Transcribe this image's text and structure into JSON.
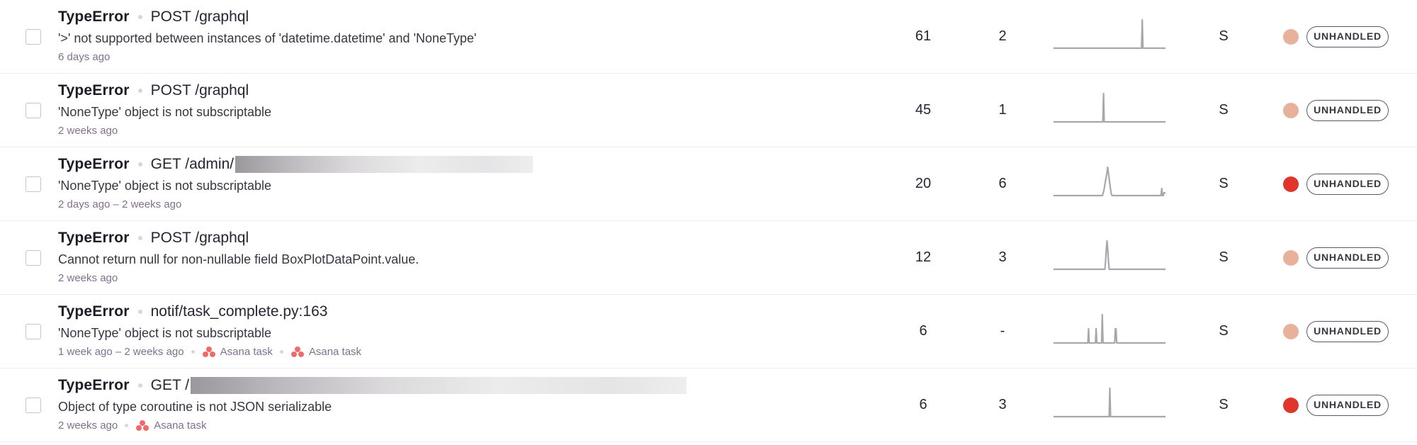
{
  "colors": {
    "priority_low": "#e8b199",
    "priority_high": "#e0352b",
    "asana": "#f06a6a",
    "sparkline": "#a9a6ad"
  },
  "issues": [
    {
      "type": "TypeError",
      "location": "POST /graphql",
      "message": "'>' not supported between instances of 'datetime.datetime' and 'NoneType'",
      "age": "6 days ago",
      "events": "61",
      "users": "2",
      "assignee": "S",
      "priority": "low",
      "status": "UNHANDLED",
      "trend": [
        0,
        0,
        0,
        0,
        0,
        0,
        0,
        0,
        0,
        0,
        0,
        0,
        0,
        0,
        0,
        0,
        0,
        0,
        0,
        0,
        0,
        0,
        0,
        0,
        0,
        0,
        0,
        0,
        0,
        0,
        0,
        0,
        0,
        0,
        0,
        0,
        0,
        0,
        0,
        0,
        0,
        0,
        0,
        0,
        0,
        0,
        0,
        0,
        0,
        0,
        0,
        0,
        0,
        0,
        0,
        0,
        0,
        0,
        0,
        0,
        0,
        0,
        0,
        0,
        0,
        0,
        0,
        0,
        0,
        0,
        0,
        0,
        0,
        0,
        0,
        0,
        0,
        0,
        0,
        0,
        0,
        0,
        0,
        0,
        0,
        0,
        0,
        0,
        0,
        0,
        0,
        0,
        0,
        0,
        0,
        0,
        0,
        0,
        0,
        0,
        0,
        0,
        0,
        0,
        0,
        0,
        0,
        0,
        0,
        0,
        0,
        0,
        0,
        0,
        0,
        0,
        0,
        0,
        0,
        0,
        0,
        0,
        0,
        0,
        0,
        0,
        1,
        0,
        0,
        0,
        0,
        0,
        0,
        0,
        0,
        0,
        0,
        0,
        0,
        0,
        0,
        0,
        0,
        0,
        0,
        0,
        0,
        0,
        0,
        0,
        0,
        0,
        0,
        0,
        0,
        0,
        0,
        0,
        0,
        0
      ],
      "asana_tasks": []
    },
    {
      "type": "TypeError",
      "location": "POST /graphql",
      "message": "'NoneType' object is not subscriptable",
      "age": "2 weeks ago",
      "events": "45",
      "users": "1",
      "assignee": "S",
      "priority": "low",
      "status": "UNHANDLED",
      "trend": [
        0,
        0,
        0,
        0,
        0,
        0,
        0,
        0,
        0,
        0,
        0,
        0,
        0,
        0,
        0,
        0,
        0,
        0,
        0,
        0,
        0,
        0,
        0,
        0,
        0,
        0,
        0,
        0,
        0,
        0,
        0,
        0,
        0,
        0,
        0,
        0,
        0,
        0,
        0,
        0,
        0,
        0,
        0,
        0,
        0,
        0,
        0,
        0,
        0,
        0,
        0,
        0,
        0,
        0,
        0,
        0,
        0,
        0,
        0,
        0,
        0,
        0,
        0,
        0,
        0,
        0,
        0,
        0,
        0,
        0,
        0,
        1,
        0,
        0,
        0,
        0,
        0,
        0,
        0,
        0,
        0,
        0,
        0,
        0,
        0,
        0,
        0,
        0,
        0,
        0,
        0,
        0,
        0,
        0,
        0,
        0,
        0,
        0,
        0,
        0,
        0,
        0,
        0,
        0,
        0,
        0,
        0,
        0,
        0,
        0,
        0,
        0,
        0,
        0,
        0,
        0,
        0,
        0,
        0,
        0,
        0,
        0,
        0,
        0,
        0,
        0,
        0,
        0,
        0,
        0,
        0,
        0,
        0,
        0,
        0,
        0,
        0,
        0,
        0,
        0,
        0,
        0,
        0,
        0,
        0,
        0,
        0,
        0,
        0,
        0,
        0,
        0,
        0,
        0,
        0,
        0,
        0,
        0,
        0,
        0
      ],
      "asana_tasks": []
    },
    {
      "type": "TypeError",
      "location": "GET /admin/",
      "location_redacted": true,
      "message": "'NoneType' object is not subscriptable",
      "age": "2 days ago – 2 weeks ago",
      "events": "20",
      "users": "6",
      "assignee": "S",
      "priority": "high",
      "status": "UNHANDLED",
      "trend": [
        0,
        0,
        0,
        0,
        0,
        0,
        0,
        0,
        0,
        0,
        0,
        0,
        0,
        0,
        0,
        0,
        0,
        0,
        0,
        0,
        0,
        0,
        0,
        0,
        0,
        0,
        0,
        0,
        0,
        0,
        0,
        0,
        0,
        0,
        0,
        0,
        0,
        0,
        0,
        0,
        0,
        0,
        0,
        0,
        0,
        0,
        0,
        0,
        0,
        0,
        0,
        0,
        0,
        0,
        0,
        0,
        0,
        0,
        0,
        0,
        0,
        0,
        0,
        0,
        0,
        0,
        0,
        0.1,
        0.2,
        0.35,
        0.5,
        0.65,
        0.8,
        1,
        0.8,
        0.6,
        0.4,
        0.2,
        0.05,
        0,
        0,
        0,
        0,
        0,
        0,
        0,
        0,
        0,
        0,
        0,
        0,
        0,
        0,
        0,
        0,
        0,
        0,
        0,
        0,
        0,
        0,
        0,
        0,
        0,
        0,
        0,
        0,
        0,
        0,
        0,
        0,
        0,
        0,
        0,
        0,
        0,
        0,
        0,
        0,
        0,
        0,
        0,
        0,
        0,
        0,
        0,
        0,
        0,
        0,
        0,
        0,
        0,
        0,
        0,
        0,
        0,
        0,
        0,
        0,
        0,
        0,
        0,
        0,
        0,
        0,
        0,
        0.25,
        0,
        0,
        0.1,
        0.1,
        0.1
      ],
      "asana_tasks": []
    },
    {
      "type": "TypeError",
      "location": "POST /graphql",
      "message": "Cannot return null for non-nullable field BoxPlotDataPoint.value.",
      "age": "2 weeks ago",
      "events": "12",
      "users": "3",
      "assignee": "S",
      "priority": "low",
      "status": "UNHANDLED",
      "trend": [
        0,
        0,
        0,
        0,
        0,
        0,
        0,
        0,
        0,
        0,
        0,
        0,
        0,
        0,
        0,
        0,
        0,
        0,
        0,
        0,
        0,
        0,
        0,
        0,
        0,
        0,
        0,
        0,
        0,
        0,
        0,
        0,
        0,
        0,
        0,
        0,
        0,
        0,
        0,
        0,
        0,
        0,
        0,
        0,
        0,
        0,
        0,
        0,
        0,
        0,
        0,
        0,
        0,
        0,
        0,
        0,
        0,
        0,
        0,
        0,
        0,
        0,
        0,
        0,
        0,
        0,
        0,
        0,
        0,
        0,
        0,
        0,
        0,
        0,
        0.3,
        0.7,
        1,
        0.7,
        0.3,
        0,
        0,
        0,
        0,
        0,
        0,
        0,
        0,
        0,
        0,
        0,
        0,
        0,
        0,
        0,
        0,
        0,
        0,
        0,
        0,
        0,
        0,
        0,
        0,
        0,
        0,
        0,
        0,
        0,
        0,
        0,
        0,
        0,
        0,
        0,
        0,
        0,
        0,
        0,
        0,
        0,
        0,
        0,
        0,
        0,
        0,
        0,
        0,
        0,
        0,
        0,
        0,
        0,
        0,
        0,
        0,
        0,
        0,
        0,
        0,
        0,
        0,
        0,
        0,
        0,
        0,
        0,
        0,
        0,
        0,
        0,
        0,
        0,
        0,
        0,
        0,
        0,
        0,
        0,
        0,
        0
      ],
      "asana_tasks": []
    },
    {
      "type": "TypeError",
      "location": "notif/task_complete.py:163",
      "message": "'NoneType' object is not subscriptable",
      "age": "1 week ago – 2 weeks ago",
      "events": "6",
      "users": "-",
      "assignee": "S",
      "priority": "low",
      "status": "UNHANDLED",
      "trend": [
        0,
        0,
        0,
        0,
        0,
        0,
        0,
        0,
        0,
        0,
        0,
        0,
        0,
        0,
        0,
        0,
        0,
        0,
        0,
        0,
        0,
        0,
        0,
        0,
        0,
        0,
        0,
        0,
        0,
        0,
        0,
        0,
        0,
        0,
        0,
        0,
        0,
        0,
        0,
        0,
        0,
        0,
        0,
        0,
        0,
        0,
        0,
        0,
        0,
        0,
        0,
        0.5,
        0,
        0,
        0,
        0,
        0,
        0,
        0,
        0,
        0,
        0,
        0.5,
        0,
        0,
        0,
        0,
        0,
        0,
        0,
        0,
        1,
        0,
        0,
        0,
        0,
        0,
        0,
        0,
        0,
        0,
        0,
        0,
        0,
        0,
        0,
        0,
        0,
        0,
        0,
        0.5,
        0.5,
        0,
        0,
        0,
        0,
        0,
        0,
        0,
        0,
        0,
        0,
        0,
        0,
        0,
        0,
        0,
        0,
        0,
        0,
        0,
        0,
        0,
        0,
        0,
        0,
        0,
        0,
        0,
        0,
        0,
        0,
        0,
        0,
        0,
        0,
        0,
        0,
        0,
        0,
        0,
        0,
        0,
        0,
        0,
        0,
        0,
        0,
        0,
        0,
        0,
        0,
        0,
        0,
        0,
        0,
        0,
        0,
        0,
        0,
        0,
        0,
        0,
        0,
        0,
        0,
        0,
        0,
        0,
        0,
        0,
        0,
        0,
        0
      ],
      "asana_tasks": [
        "Asana task",
        "Asana task"
      ]
    },
    {
      "type": "TypeError",
      "location": "GET /",
      "location_redacted": true,
      "message": "Object of type coroutine is not JSON serializable",
      "age": "2 weeks ago",
      "events": "6",
      "users": "3",
      "assignee": "S",
      "priority": "high",
      "status": "UNHANDLED",
      "trend": [
        0,
        0,
        0,
        0,
        0,
        0,
        0,
        0,
        0,
        0,
        0,
        0,
        0,
        0,
        0,
        0,
        0,
        0,
        0,
        0,
        0,
        0,
        0,
        0,
        0,
        0,
        0,
        0,
        0,
        0,
        0,
        0,
        0,
        0,
        0,
        0,
        0,
        0,
        0,
        0,
        0,
        0,
        0,
        0,
        0,
        0,
        0,
        0,
        0,
        0,
        0,
        0,
        0,
        0,
        0,
        0,
        0,
        0,
        0,
        0,
        0,
        0,
        0,
        0,
        0,
        0,
        0,
        0,
        0,
        0,
        0,
        0,
        0,
        0,
        0,
        0,
        0,
        0,
        0,
        0,
        1,
        0,
        0,
        0,
        0,
        0,
        0,
        0,
        0,
        0,
        0,
        0,
        0,
        0,
        0,
        0,
        0,
        0,
        0,
        0,
        0,
        0,
        0,
        0,
        0,
        0,
        0,
        0,
        0,
        0,
        0,
        0,
        0,
        0,
        0,
        0,
        0,
        0,
        0,
        0,
        0,
        0,
        0,
        0,
        0,
        0,
        0,
        0,
        0,
        0,
        0,
        0,
        0,
        0,
        0,
        0,
        0,
        0,
        0,
        0,
        0,
        0,
        0,
        0,
        0,
        0,
        0,
        0,
        0,
        0,
        0,
        0,
        0,
        0,
        0,
        0,
        0,
        0,
        0,
        0
      ],
      "asana_tasks": [
        "Asana task"
      ]
    }
  ]
}
